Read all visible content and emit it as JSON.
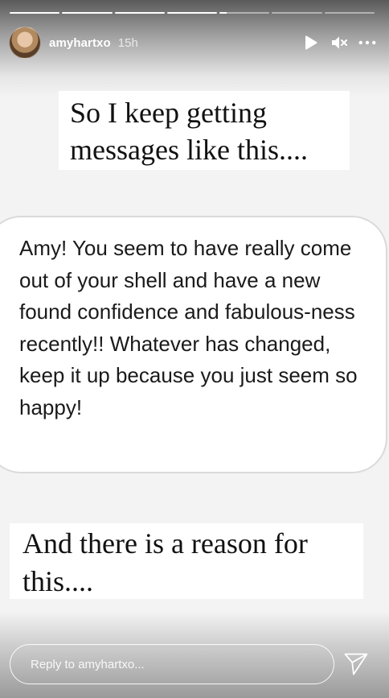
{
  "progress": {
    "segments": [
      1,
      1,
      1,
      1,
      0.15,
      0,
      0
    ],
    "active_color": "#ffffff"
  },
  "header": {
    "username": "amyhartxo",
    "time": "15h",
    "icons": [
      "play-icon",
      "mute-icon",
      "more-icon"
    ]
  },
  "content": {
    "headline_top": "So I keep getting messages like this....",
    "message": "Amy! You seem to have really come out of your shell and have a new found confidence and fabulous-ness recently!! Whatever has changed, keep it up because you just seem so happy!",
    "headline_bottom": "And there is a reason for this...."
  },
  "reply": {
    "placeholder": "Reply to amyhartxo..."
  }
}
